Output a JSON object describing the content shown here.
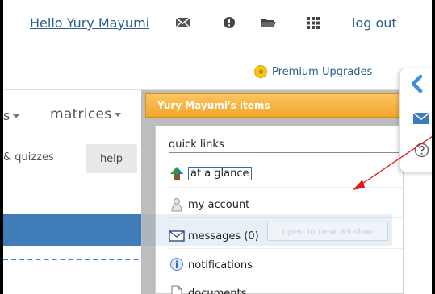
{
  "topnav": {
    "greeting": "Hello Yury Mayumi",
    "logout_label": "log out",
    "icons": [
      "envelope-icon",
      "alert-icon",
      "folder-icon",
      "grid-icon"
    ]
  },
  "premium": {
    "label": "Premium Upgrades",
    "coin_color": "#f5c518"
  },
  "menu": {
    "fragment": "s",
    "matrices_label": "matrices",
    "tab_fragment": "& quizzes",
    "help_label": "help"
  },
  "items_panel": {
    "title": "Yury Mayumi's items",
    "section_title": "quick links",
    "items": [
      {
        "label": "at a glance",
        "icon": "at-a-glance-icon"
      },
      {
        "label": "my account",
        "icon": "person-icon"
      },
      {
        "label": "messages (0)",
        "icon": "envelope-icon"
      },
      {
        "label": "notifications",
        "icon": "info-icon"
      },
      {
        "label": "documents",
        "icon": "document-icon"
      }
    ],
    "open_new_window": "open in new window"
  },
  "colors": {
    "header_orange": "#f3a52a",
    "link_blue": "#2d5e8c",
    "band_blue": "#3f7db9",
    "arrow_red": "#e01b1b"
  }
}
